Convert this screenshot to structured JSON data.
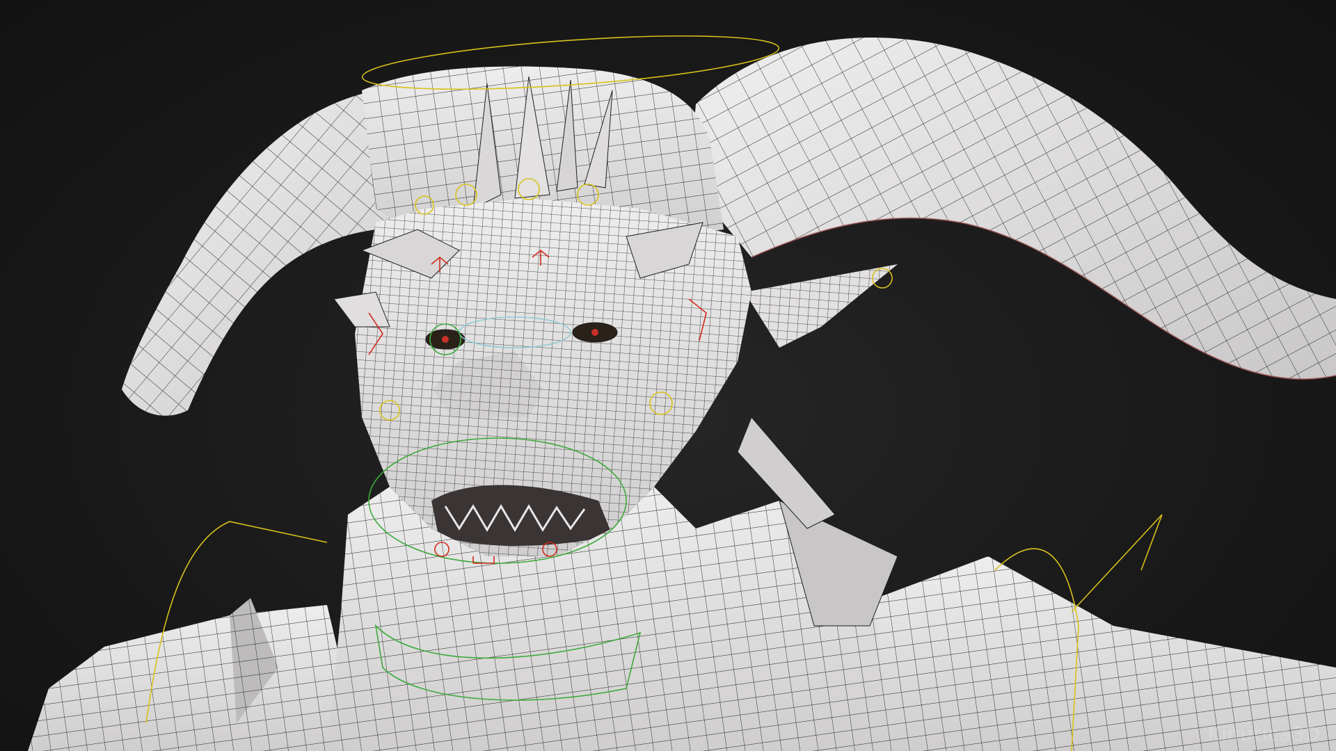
{
  "viewport": {
    "background_color": "#1a1a1a",
    "mesh_color": "#e6e4e4",
    "wire_color": "#1e1e1e",
    "rig_colors": {
      "yellow": "#d8c21a",
      "red": "#d22a1e",
      "green": "#3caa3c",
      "cyan": "#8fc9d6"
    }
  },
  "watermark": {
    "text": "Kinutica3D"
  }
}
